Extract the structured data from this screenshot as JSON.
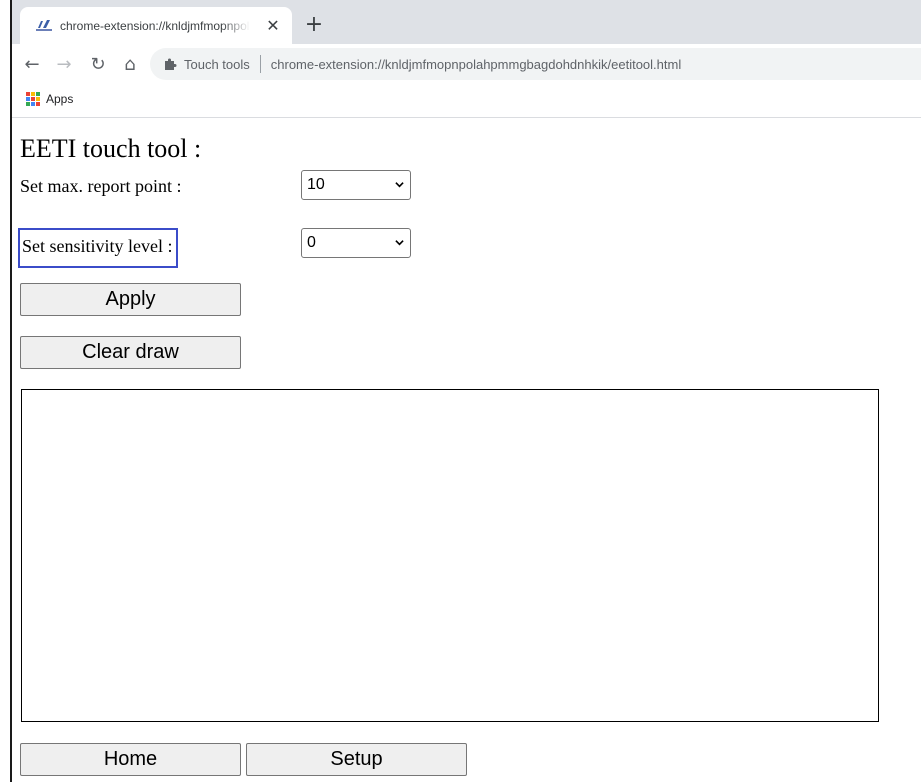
{
  "browser": {
    "tab": {
      "title": "chrome-extension://knldjmfmopnpolahpmmgbagdohdnhkik/eetitool.html",
      "close_glyph": "✕",
      "icon": "extension-favicon-icon"
    },
    "new_tab_glyph": "+",
    "toolbar": {
      "back_glyph": "←",
      "forward_glyph": "→",
      "reload_glyph": "↻",
      "home_glyph": "⌂"
    },
    "omnibox": {
      "site_name": "Touch tools",
      "url": "chrome-extension://knldjmfmopnpolahpmmgbagdohdnhkik/eetitool.html",
      "icon": "puzzle-piece-icon"
    },
    "bookmarks": {
      "apps_label": "Apps",
      "apps_colors": [
        "#ea4335",
        "#fbbc05",
        "#34a853",
        "#4285f4",
        "#ea4335",
        "#fbbc05",
        "#34a853",
        "#4285f4",
        "#ea4335"
      ]
    }
  },
  "page": {
    "title": "EETI touch tool :",
    "max_report_label": "Set max. report point :",
    "max_report_value": "10",
    "sensitivity_label": "Set sensitivity level :",
    "sensitivity_value": "0",
    "apply_label": "Apply",
    "clear_label": "Clear draw",
    "home_label": "Home",
    "setup_label": "Setup"
  },
  "colors": {
    "highlight_border": "#3b4cc9",
    "tabstrip_bg": "#dee1e6",
    "omnibox_bg": "#f1f3f4"
  }
}
